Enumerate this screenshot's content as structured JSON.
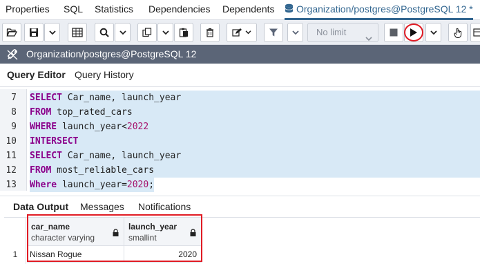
{
  "tabs": {
    "items": [
      "Properties",
      "SQL",
      "Statistics",
      "Dependencies",
      "Dependents"
    ],
    "active": "Organization/postgres@PostgreSQL 12 *"
  },
  "toolbar": {
    "limit_value": "No limit"
  },
  "connection": {
    "label": "Organization/postgres@PostgreSQL 12"
  },
  "query_tabs": {
    "editor": "Query Editor",
    "history": "Query History"
  },
  "editor": {
    "lines": [
      {
        "num": "7",
        "text": "SELECT Car_name, launch_year"
      },
      {
        "num": "8",
        "text": "FROM top_rated_cars"
      },
      {
        "num": "9",
        "text": "WHERE launch_year<2022"
      },
      {
        "num": "10",
        "text": "INTERSECT"
      },
      {
        "num": "11",
        "text": "SELECT Car_name, launch_year"
      },
      {
        "num": "12",
        "text": "FROM most_reliable_cars"
      },
      {
        "num": "13",
        "text": "Where launch_year=2020;"
      }
    ]
  },
  "results": {
    "tabs": {
      "data_output": "Data Output",
      "messages": "Messages",
      "notifications": "Notifications"
    },
    "columns": [
      {
        "name": "car_name",
        "type": "character varying"
      },
      {
        "name": "launch_year",
        "type": "smallint"
      }
    ],
    "rows": [
      {
        "index": "1",
        "cells": [
          "Nissan Rogue",
          "2020"
        ]
      }
    ]
  },
  "colors": {
    "accent": "#326690",
    "connection_bar": "#5b6577",
    "keyword": "#8b008b",
    "literal": "#a6126b",
    "selection": "#d8e9f6",
    "annotation": "#e01b24"
  },
  "icons": [
    "database-icon",
    "folder-open-icon",
    "save-icon",
    "chevron-down-icon",
    "grid-icon",
    "search-icon",
    "copy-icon",
    "paste-icon",
    "trash-icon",
    "edit-icon",
    "filter-icon",
    "stop-icon",
    "play-icon",
    "hand-icon",
    "lock-icon",
    "connection-icon"
  ]
}
